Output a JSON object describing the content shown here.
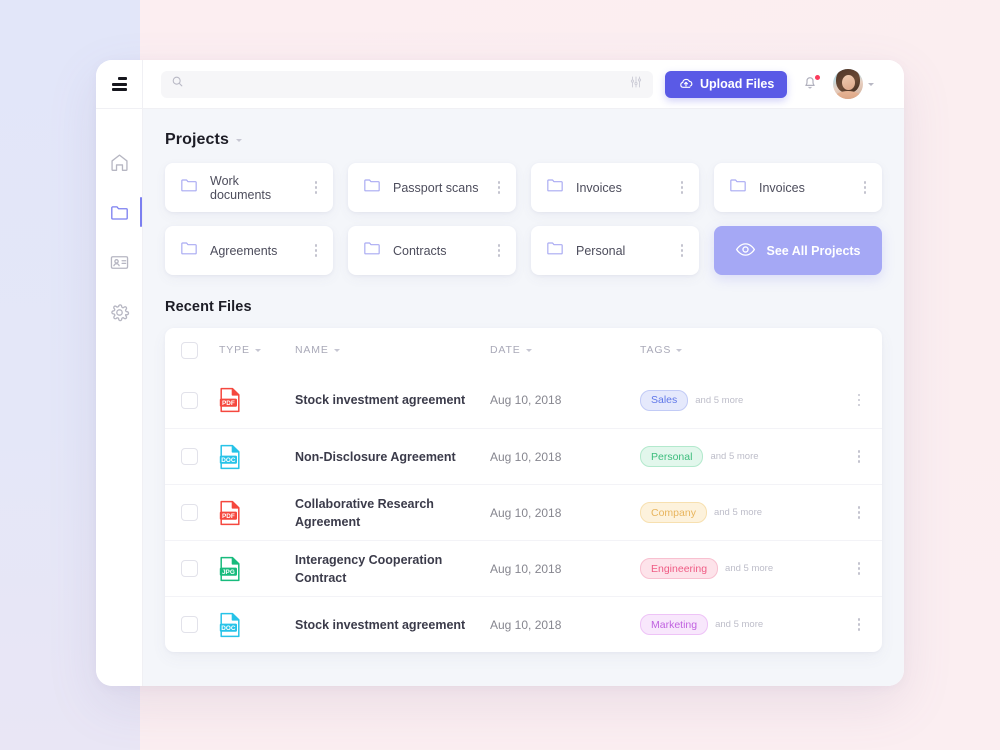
{
  "background": {
    "left_color": "#e3e7f9",
    "right_color": "#fbeef0"
  },
  "sidebar": {
    "logo_icon": "hamburger-menu-icon",
    "items": [
      {
        "icon": "home-icon",
        "name": "home",
        "active": false
      },
      {
        "icon": "folder-icon",
        "name": "files",
        "active": true
      },
      {
        "icon": "id-card-icon",
        "name": "contacts",
        "active": false
      },
      {
        "icon": "gear-icon",
        "name": "settings",
        "active": false
      }
    ]
  },
  "topbar": {
    "search": {
      "value": "",
      "placeholder": "",
      "icon": "search-icon",
      "filter_icon": "sliders-icon"
    },
    "upload": {
      "label": "Upload Files",
      "icon": "cloud-upload-icon",
      "color": "#5a5ae6"
    },
    "notifications": {
      "icon": "bell-icon",
      "has_badge": true,
      "badge_color": "#fb3b5c"
    },
    "avatar": {
      "name": "avatar",
      "caret": "chevron-down-icon"
    }
  },
  "projects": {
    "title": "Projects",
    "caret_icon": "chevron-down-icon",
    "cards": [
      {
        "label": "Work documents",
        "icon": "folder-icon",
        "menu_icon": "kebab-menu-icon"
      },
      {
        "label": "Passport scans",
        "icon": "folder-icon",
        "menu_icon": "kebab-menu-icon"
      },
      {
        "label": "Invoices",
        "icon": "folder-icon",
        "menu_icon": "kebab-menu-icon"
      },
      {
        "label": "Invoices",
        "icon": "folder-icon",
        "menu_icon": "kebab-menu-icon"
      },
      {
        "label": "Agreements",
        "icon": "folder-icon",
        "menu_icon": "kebab-menu-icon"
      },
      {
        "label": "Contracts",
        "icon": "folder-icon",
        "menu_icon": "kebab-menu-icon"
      },
      {
        "label": "Personal",
        "icon": "folder-icon",
        "menu_icon": "kebab-menu-icon"
      }
    ],
    "see_all": {
      "label": "See All Projects",
      "icon": "eye-icon",
      "color": "#a5a8f5"
    }
  },
  "recent_files": {
    "title": "Recent Files",
    "columns": [
      {
        "label": "TYPE",
        "caret": "chevron-down-icon"
      },
      {
        "label": "NAME",
        "caret": "chevron-down-icon"
      },
      {
        "label": "DATE",
        "caret": "chevron-down-icon"
      },
      {
        "label": "TAGS",
        "caret": "chevron-down-icon"
      }
    ],
    "rows": [
      {
        "filetype": "PDF",
        "filetype_color": "#f5483f",
        "name": "Stock investment agreement",
        "date": "Aug 10, 2018",
        "tag": "Sales",
        "tag_text_color": "#5f77e8",
        "tag_bg_color": "#e5e9fc",
        "tag_border_color": "#c2cbf6",
        "more": "and 5 more"
      },
      {
        "filetype": "DOC",
        "filetype_color": "#27c3e8",
        "name": "Non-Disclosure Agreement",
        "date": "Aug 10, 2018",
        "tag": "Personal",
        "tag_text_color": "#3dbd7d",
        "tag_bg_color": "#e2f7ec",
        "tag_border_color": "#b3e9cd",
        "more": "and 5 more"
      },
      {
        "filetype": "PDF",
        "filetype_color": "#f5483f",
        "name": "Collaborative Research Agreement",
        "date": "Aug 10, 2018",
        "tag": "Company",
        "tag_text_color": "#e8b55e",
        "tag_bg_color": "#fdf2dc",
        "tag_border_color": "#f7e0b0",
        "more": "and 5 more"
      },
      {
        "filetype": "JPG",
        "filetype_color": "#18bb7d",
        "name": "Interagency Cooperation Contract",
        "date": "Aug 10, 2018",
        "tag": "Engineering",
        "tag_text_color": "#ef5b84",
        "tag_bg_color": "#fde3ea",
        "tag_border_color": "#f8c0d0",
        "more": "and 5 more"
      },
      {
        "filetype": "DOC",
        "filetype_color": "#27c3e8",
        "name": "Stock investment agreement",
        "date": "Aug 10, 2018",
        "tag": "Marketing",
        "tag_text_color": "#c062e0",
        "tag_bg_color": "#f8e7fc",
        "tag_border_color": "#eec3f7",
        "more": "and 5 more"
      }
    ],
    "row_menu_icon": "kebab-menu-icon",
    "select_all_checkbox": "checkbox"
  }
}
